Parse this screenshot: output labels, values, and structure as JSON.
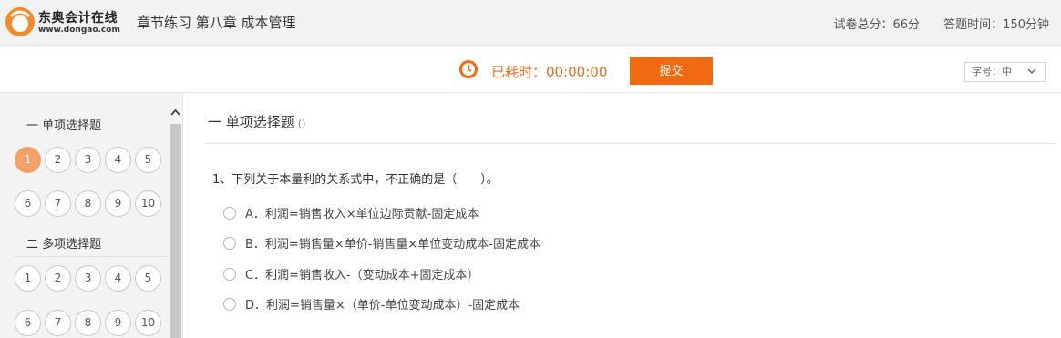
{
  "header": {
    "brand": "东奥会计在线",
    "brand_url": "www.dongao.com",
    "title": "章节练习 第八章 成本管理",
    "total_score": "试卷总分：66分",
    "exam_time": "答题时间：150分钟"
  },
  "toolbar": {
    "elapsed": "已耗时：00:00:00",
    "submit_label": "提交",
    "font_size_label": "字号：中"
  },
  "sidebar": {
    "sections": [
      {
        "title": "一 单项选择题",
        "numbers": [
          "1",
          "2",
          "3",
          "4",
          "5",
          "6",
          "7",
          "8",
          "9",
          "10"
        ],
        "current": "1"
      },
      {
        "title": "二 多项选择题",
        "numbers": [
          "1",
          "2",
          "3",
          "4",
          "5",
          "6",
          "7",
          "8",
          "9",
          "10"
        ]
      }
    ]
  },
  "main": {
    "section_heading": "一 单项选择题",
    "section_paren": "()",
    "question": "1、下列关于本量利的关系式中，不正确的是（　　）。",
    "options": [
      "A．利润=销售收入×单位边际贡献-固定成本",
      "B．利润=销售量×单价-销售量×单位变动成本-固定成本",
      "C．利润=销售收入-（变动成本+固定成本）",
      "D．利润=销售量×（单价-单位变动成本）-固定成本"
    ]
  },
  "colors": {
    "accent": "#f26a10",
    "active_number": "#f5a06a",
    "header_bg": "#f2f2f2",
    "sidebar_bg": "#f3f3f3"
  },
  "icons": [
    "dongao-logo",
    "clock-icon",
    "chevron-down-icon",
    "chevron-up-icon"
  ]
}
